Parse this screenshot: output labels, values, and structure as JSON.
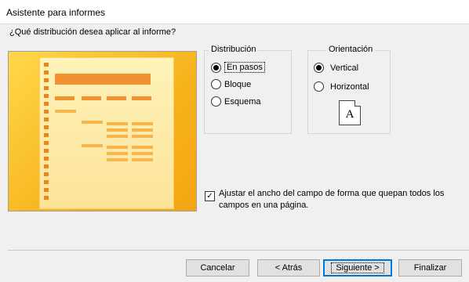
{
  "window": {
    "title": "Asistente para informes"
  },
  "question": "¿Qué distribución desea aplicar al informe?",
  "distribution": {
    "label": "Distribución",
    "options": [
      "En pasos",
      "Bloque",
      "Esquema"
    ],
    "selected": "En pasos"
  },
  "orientation": {
    "label": "Orientación",
    "options": [
      "Vertical",
      "Horizontal"
    ],
    "selected": "Vertical",
    "icon_letter": "A"
  },
  "adjust_width": {
    "checked": true,
    "label": "Ajustar el ancho del campo de forma que quepan todos los campos en una página."
  },
  "buttons": {
    "cancel": "Cancelar",
    "back": "< Atrás",
    "next": "Siguiente >",
    "finish": "Finalizar"
  },
  "colors": {
    "accent": "#0078d7",
    "preview_orange": "#f2912f",
    "preview_bg": "#f7b31c"
  }
}
